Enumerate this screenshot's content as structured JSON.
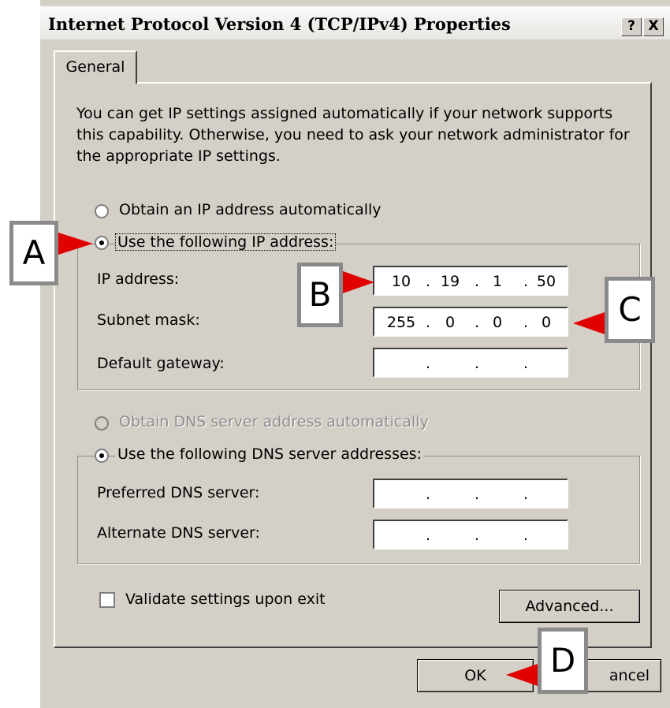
{
  "window": {
    "title": "Internet Protocol Version 4 (TCP/IPv4) Properties",
    "help_button": "?",
    "close_button": "X"
  },
  "tabs": [
    {
      "label": "General"
    }
  ],
  "description": "You can get IP settings assigned automatically if your network supports this capability. Otherwise, you need to ask your network administrator for the appropriate IP settings.",
  "ip_mode": {
    "auto_label": "Obtain an IP address automatically",
    "manual_label": "Use the following IP address:",
    "selected": "manual"
  },
  "ip_fields": {
    "ip_address": {
      "label": "IP address:",
      "octets": [
        "10",
        "19",
        "1",
        "50"
      ]
    },
    "subnet_mask": {
      "label": "Subnet mask:",
      "octets": [
        "255",
        "0",
        "0",
        "0"
      ]
    },
    "default_gateway": {
      "label": "Default gateway:",
      "octets": [
        "",
        "",
        "",
        ""
      ]
    }
  },
  "dns_mode": {
    "auto_label": "Obtain DNS server address automatically",
    "manual_label": "Use the following DNS server addresses:",
    "selected": "manual",
    "auto_disabled": true
  },
  "dns_fields": {
    "preferred": {
      "label": "Preferred DNS server:",
      "octets": [
        "",
        "",
        "",
        ""
      ]
    },
    "alternate": {
      "label": "Alternate DNS server:",
      "octets": [
        "",
        "",
        "",
        ""
      ]
    }
  },
  "validate": {
    "label": "Validate settings upon exit",
    "checked": false
  },
  "buttons": {
    "advanced": "Advanced...",
    "ok": "OK",
    "cancel": "ancel"
  },
  "callouts": {
    "a": "A",
    "b": "B",
    "c": "C",
    "d": "D"
  },
  "colors": {
    "arrow": "#e00000",
    "callout_border": "#8a8a8a",
    "dialog_bg": "#d4d0c8"
  }
}
